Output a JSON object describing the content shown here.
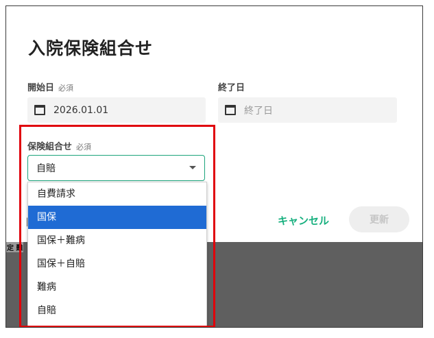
{
  "dialog": {
    "title": "入院保険組合せ",
    "start_date": {
      "label": "開始日",
      "required": "必須",
      "value": "2026.01.01"
    },
    "end_date": {
      "label": "終了日",
      "placeholder": "終了日"
    },
    "insurance_combo": {
      "label": "保険組合せ",
      "required": "必須",
      "selected": "自賠"
    },
    "cancel_label": "キャンセル",
    "update_label": "更新"
  },
  "dropdown": {
    "options": [
      "自費請求",
      "国保",
      "国保＋難病",
      "国保＋自賠",
      "難病",
      "自賠"
    ],
    "highlighted_index": 1
  },
  "backdrop": {
    "text": "定 難"
  },
  "colors": {
    "accent": "#18b07f",
    "selected_option": "#1f6bd4",
    "annotation": "#e0000a"
  }
}
